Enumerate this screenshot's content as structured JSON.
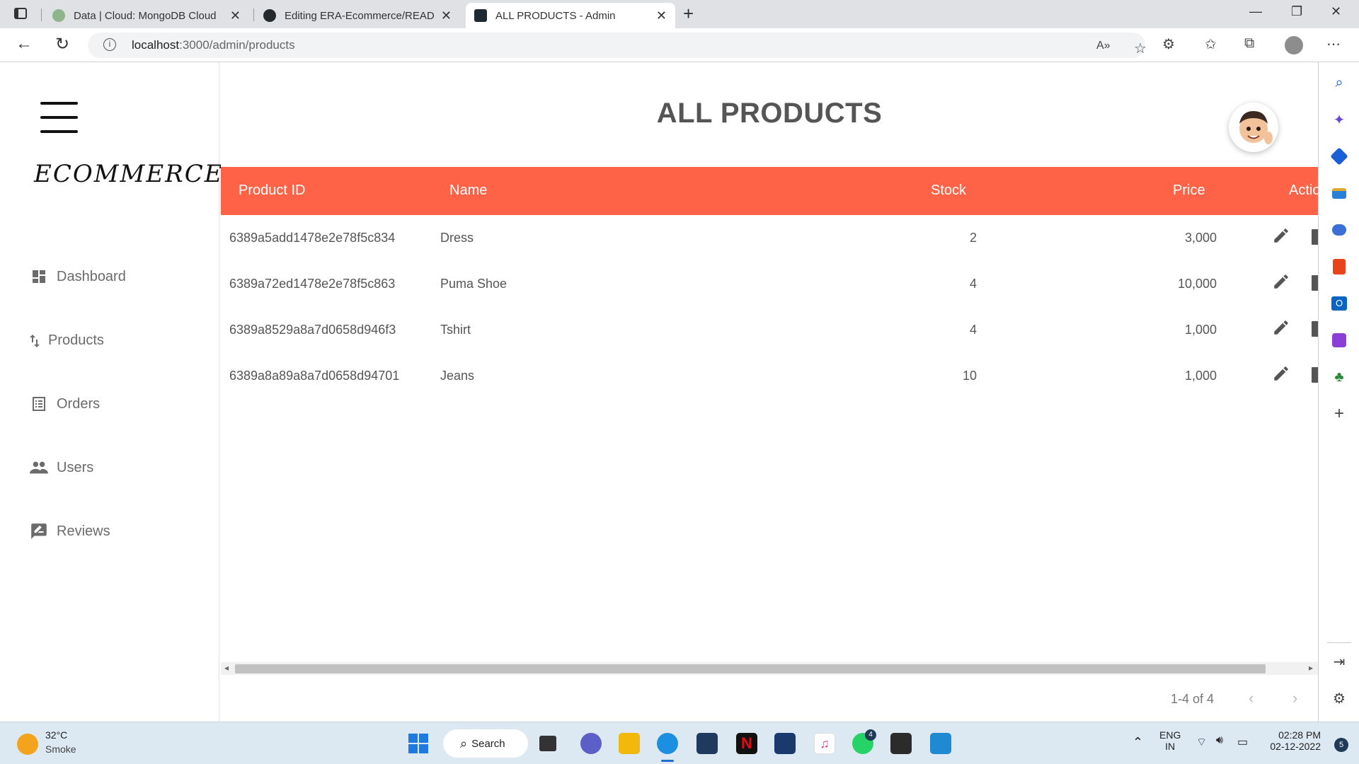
{
  "browser": {
    "tabs": [
      {
        "title": "Data | Cloud: MongoDB Cloud",
        "active": false
      },
      {
        "title": "Editing ERA-Ecommerce/README",
        "active": false
      },
      {
        "title": "ALL PRODUCTS - Admin",
        "active": true
      }
    ],
    "url": "localhost:3000/admin/products",
    "url_display_host": "localhost",
    "url_display_path": ":3000/admin/products"
  },
  "sidebar": {
    "brand": "ECOMMERCE.",
    "items": [
      {
        "label": "Dashboard",
        "icon": "dashboard-icon"
      },
      {
        "label": "Products",
        "icon": "import-export-icon"
      },
      {
        "label": "Orders",
        "icon": "list-alt-icon"
      },
      {
        "label": "Users",
        "icon": "people-icon"
      },
      {
        "label": "Reviews",
        "icon": "rate-review-icon"
      }
    ]
  },
  "main": {
    "title": "ALL PRODUCTS",
    "table": {
      "headers": [
        "Product ID",
        "Name",
        "Stock",
        "Price",
        "Actions"
      ],
      "rows": [
        {
          "id": "6389a5add1478e2e78f5c834",
          "name": "Dress",
          "stock": "2",
          "price": "3,000"
        },
        {
          "id": "6389a72ed1478e2e78f5c863",
          "name": "Puma Shoe",
          "stock": "4",
          "price": "10,000"
        },
        {
          "id": "6389a8529a8a7d0658d946f3",
          "name": "Tshirt",
          "stock": "4",
          "price": "1,000"
        },
        {
          "id": "6389a8a89a8a7d0658d94701",
          "name": "Jeans",
          "stock": "10",
          "price": "1,000"
        }
      ]
    },
    "pagination": "1-4 of 4"
  },
  "taskbar": {
    "weather_temp": "32°C",
    "weather_desc": "Smoke",
    "search_label": "Search",
    "lang_top": "ENG",
    "lang_bottom": "IN",
    "time": "02:28 PM",
    "date": "02-12-2022",
    "whatsapp_badge": "4",
    "notification_count": "5"
  },
  "colors": {
    "accent": "#ff6347",
    "table_header_text": "#ffffff",
    "sidebar_text": "#6b6b6b"
  }
}
